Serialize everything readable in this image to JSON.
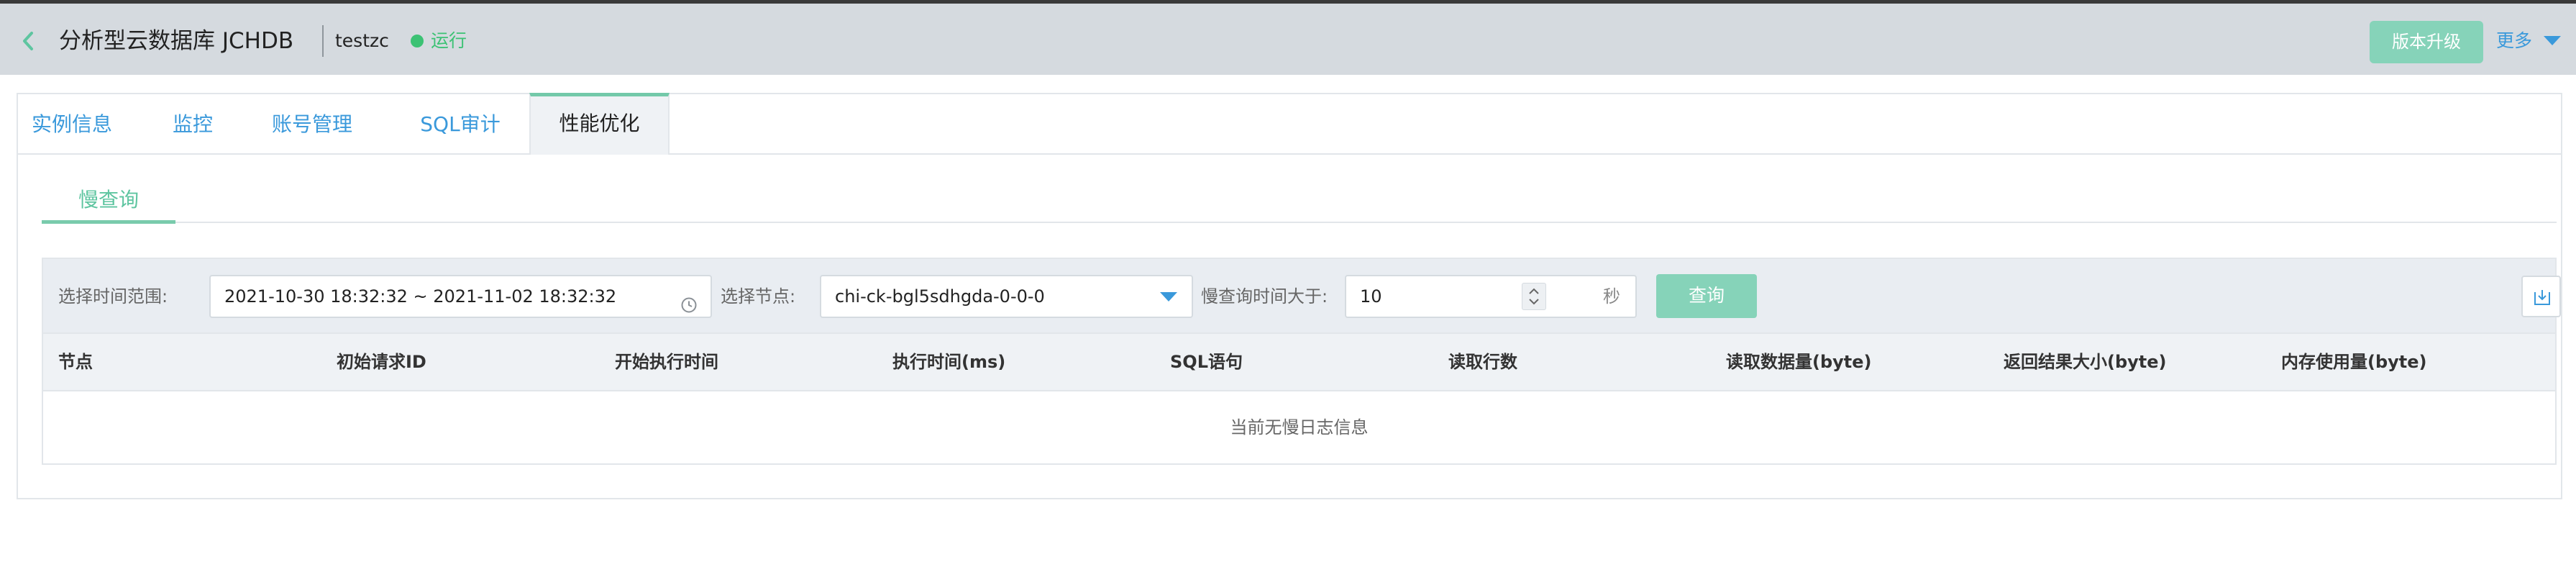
{
  "header": {
    "title": "分析型云数据库 JCHDB",
    "instance_name": "testzc",
    "status": "运行",
    "upgrade_label": "版本升级",
    "more_label": "更多"
  },
  "tabs": [
    {
      "label": "实例信息"
    },
    {
      "label": "监控"
    },
    {
      "label": "账号管理"
    },
    {
      "label": "SQL审计"
    },
    {
      "label": "性能优化"
    }
  ],
  "active_tab": "性能优化",
  "subtab": {
    "label": "慢查询"
  },
  "filters": {
    "time_range_label": "选择时间范围:",
    "time_range_value": "2021-10-30 18:32:32 ~ 2021-11-02 18:32:32",
    "node_label": "选择节点:",
    "node_value": "chi-ck-bgl5sdhgda-0-0-0",
    "threshold_label": "慢查询时间大于:",
    "threshold_value": "10",
    "threshold_unit": "秒",
    "query_label": "查询"
  },
  "table": {
    "columns": [
      "节点",
      "初始请求ID",
      "开始执行时间",
      "执行时间(ms)",
      "SQL语句",
      "读取行数",
      "读取数据量(byte)",
      "返回结果大小(byte)",
      "内存使用量(byte)"
    ],
    "empty_text": "当前无慢日志信息"
  },
  "colors": {
    "accent_green": "#86d3b9",
    "link_blue": "#3a99db",
    "status_green": "#3cc274"
  }
}
